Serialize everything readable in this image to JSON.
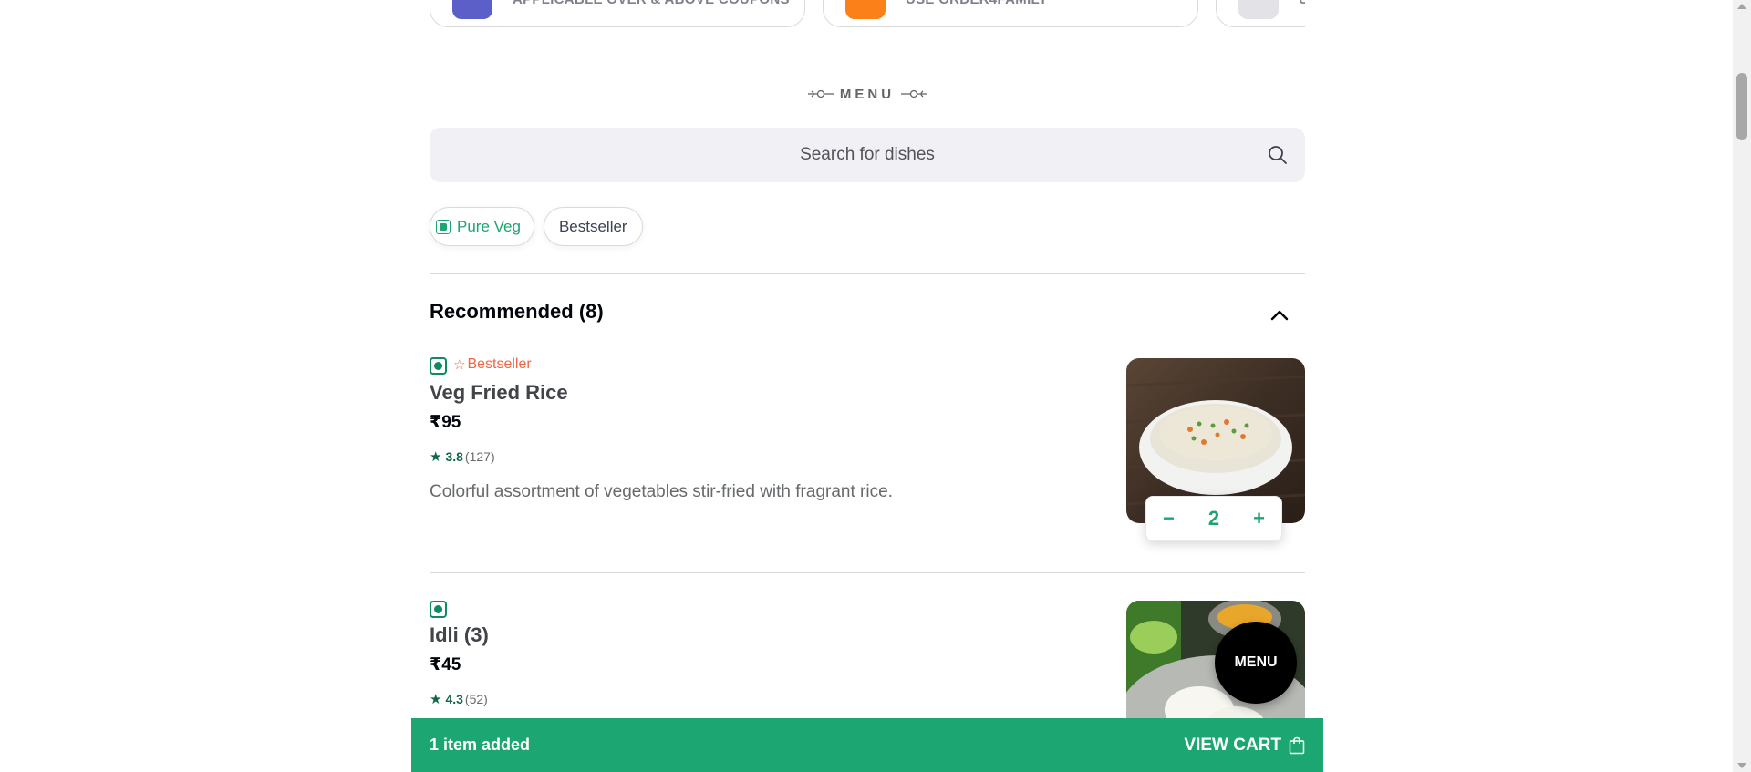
{
  "offers": [
    {
      "text": "APPLICABLE OVER & ABOVE COUPONS",
      "icon": "offer-badge-icon",
      "color": "#5b5fc7"
    },
    {
      "text": "USE ORDER4FAMILY",
      "icon": "offer-badge-icon",
      "color": "#fc8019"
    },
    {
      "text": "U",
      "icon": "offer-badge-icon",
      "color": "#d9dadb"
    }
  ],
  "menu": {
    "heading": "MENU",
    "search_placeholder": "Search for dishes"
  },
  "filters": {
    "pure_veg": "Pure Veg",
    "bestseller": "Bestseller"
  },
  "section": {
    "title": "Recommended (8)"
  },
  "items": [
    {
      "bestseller_label": "Bestseller",
      "name": "Veg Fried Rice",
      "price": "₹95",
      "rating": "3.8",
      "rating_count": "(127)",
      "description": "Colorful assortment of vegetables stir-fried with fragrant rice.",
      "quantity": "2"
    },
    {
      "name": "Idli (3)",
      "price": "₹45",
      "rating": "4.3",
      "rating_count": "(52)"
    }
  ],
  "menu_fab": "MENU",
  "cart": {
    "added_text": "1 item added",
    "view_cart": "VIEW CART"
  },
  "colors": {
    "accent": "#1ba672",
    "bestseller": "#ee6644",
    "veg": "#0f8a65"
  }
}
